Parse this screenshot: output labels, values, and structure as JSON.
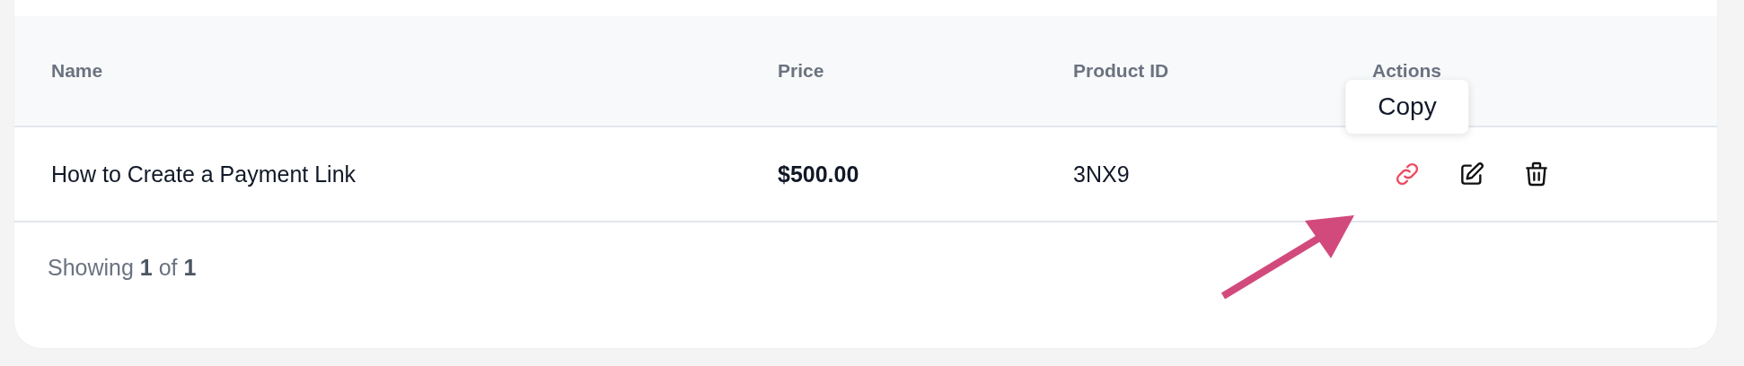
{
  "table": {
    "columns": [
      "Name",
      "Price",
      "Product ID",
      "Actions"
    ],
    "rows": [
      {
        "name": "How to Create a Payment Link",
        "price": "$500.00",
        "product_id": "3NX9",
        "actions": [
          {
            "kind": "link",
            "highlighted": true,
            "tooltip": "Copy"
          },
          {
            "kind": "edit",
            "highlighted": false
          },
          {
            "kind": "delete",
            "highlighted": false
          }
        ]
      }
    ]
  },
  "footer": "Showing **1** of **1**",
  "annotation": {
    "kind": "arrow"
  }
}
